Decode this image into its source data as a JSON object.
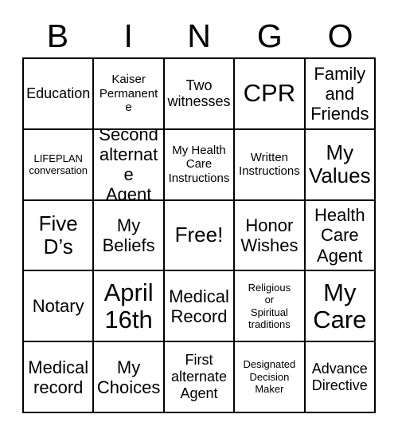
{
  "card": {
    "title": "BINGO",
    "header_letters": [
      "B",
      "I",
      "N",
      "G",
      "O"
    ],
    "grid_size": "5x5",
    "border_color": "#000000",
    "background_color": "#ffffff",
    "text_color": "#000000",
    "free_space": "Free!",
    "cells": [
      {
        "row": 1,
        "col": 1,
        "column_letter": "B",
        "text": "Education",
        "size": "md",
        "free": false
      },
      {
        "row": 1,
        "col": 2,
        "column_letter": "I",
        "text": "Kaiser\nPermanente",
        "size": "sm",
        "free": false
      },
      {
        "row": 1,
        "col": 3,
        "column_letter": "N",
        "text": "Two\nwitnesses",
        "size": "md",
        "free": false
      },
      {
        "row": 1,
        "col": 4,
        "column_letter": "G",
        "text": "CPR",
        "size": "xxl",
        "free": false
      },
      {
        "row": 1,
        "col": 5,
        "column_letter": "O",
        "text": "Family\nand\nFriends",
        "size": "lg",
        "free": false
      },
      {
        "row": 2,
        "col": 1,
        "column_letter": "B",
        "text": "LIFEPLAN\nconversation",
        "size": "xs",
        "free": false
      },
      {
        "row": 2,
        "col": 2,
        "column_letter": "I",
        "text": "Second\nalternate\nAgent",
        "size": "lg",
        "free": false
      },
      {
        "row": 2,
        "col": 3,
        "column_letter": "N",
        "text": "My Health\nCare\nInstructions",
        "size": "sm",
        "free": false
      },
      {
        "row": 2,
        "col": 4,
        "column_letter": "G",
        "text": "Written\nInstructions",
        "size": "sm",
        "free": false
      },
      {
        "row": 2,
        "col": 5,
        "column_letter": "O",
        "text": "My\nValues",
        "size": "xl",
        "free": false
      },
      {
        "row": 3,
        "col": 1,
        "column_letter": "B",
        "text": "Five\nD’s",
        "size": "xl",
        "free": false
      },
      {
        "row": 3,
        "col": 2,
        "column_letter": "I",
        "text": "My\nBeliefs",
        "size": "lg",
        "free": false
      },
      {
        "row": 3,
        "col": 3,
        "column_letter": "N",
        "text": "Free!",
        "size": "xl",
        "free": true
      },
      {
        "row": 3,
        "col": 4,
        "column_letter": "G",
        "text": "Honor\nWishes",
        "size": "lg",
        "free": false
      },
      {
        "row": 3,
        "col": 5,
        "column_letter": "O",
        "text": "Health\nCare\nAgent",
        "size": "lg",
        "free": false
      },
      {
        "row": 4,
        "col": 1,
        "column_letter": "B",
        "text": "Notary",
        "size": "lg",
        "free": false
      },
      {
        "row": 4,
        "col": 2,
        "column_letter": "I",
        "text": "April\n16th",
        "size": "xxl",
        "free": false
      },
      {
        "row": 4,
        "col": 3,
        "column_letter": "N",
        "text": "Medical\nRecord",
        "size": "lg",
        "free": false
      },
      {
        "row": 4,
        "col": 4,
        "column_letter": "G",
        "text": "Religious\nor\nSpiritual\ntraditions",
        "size": "xs",
        "free": false
      },
      {
        "row": 4,
        "col": 5,
        "column_letter": "O",
        "text": "My\nCare",
        "size": "xxl",
        "free": false
      },
      {
        "row": 5,
        "col": 1,
        "column_letter": "B",
        "text": "Medical\nrecord",
        "size": "lg",
        "free": false
      },
      {
        "row": 5,
        "col": 2,
        "column_letter": "I",
        "text": "My\nChoices",
        "size": "lg",
        "free": false
      },
      {
        "row": 5,
        "col": 3,
        "column_letter": "N",
        "text": "First\nalternate\nAgent",
        "size": "md",
        "free": false
      },
      {
        "row": 5,
        "col": 4,
        "column_letter": "G",
        "text": "Designated\nDecision\nMaker",
        "size": "xs",
        "free": false
      },
      {
        "row": 5,
        "col": 5,
        "column_letter": "O",
        "text": "Advance\nDirective",
        "size": "md",
        "free": false
      }
    ]
  }
}
